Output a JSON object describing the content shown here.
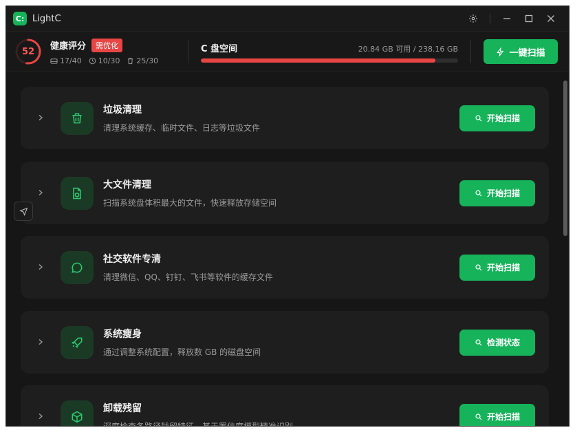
{
  "app": {
    "logo_text": "C:",
    "title": "LightC"
  },
  "health": {
    "score": "52",
    "score_fraction": 0.52,
    "title": "健康评分",
    "badge": "需优化",
    "stats": [
      "17/40",
      "10/30",
      "25/30"
    ]
  },
  "disk": {
    "title": "C 盘空间",
    "usage": "20.84 GB 可用 / 238.16 GB",
    "used_fraction": 0.9125
  },
  "header": {
    "scan_all_label": "一键扫描"
  },
  "cards": [
    {
      "title": "垃圾清理",
      "desc": "清理系统缓存、临时文件、日志等垃圾文件",
      "button": "开始扫描",
      "icon": "trash-icon"
    },
    {
      "title": "大文件清理",
      "desc": "扫描系统盘体积最大的文件，快速释放存储空间",
      "button": "开始扫描",
      "icon": "file-box-icon"
    },
    {
      "title": "社交软件专清",
      "desc": "清理微信、QQ、钉钉、飞书等软件的缓存文件",
      "button": "开始扫描",
      "icon": "chat-icon"
    },
    {
      "title": "系统瘦身",
      "desc": "通过调整系统配置，释放数 GB 的磁盘空间",
      "button": "检测状态",
      "icon": "rocket-icon"
    },
    {
      "title": "卸载残留",
      "desc": "深度检查各路径残留特征，基于置信度模型精准识别",
      "button": "开始扫描",
      "icon": "package-icon"
    }
  ],
  "colors": {
    "accent": "#16b35a",
    "danger": "#e84545",
    "bg": "#161616",
    "card": "#1e1e1e"
  }
}
